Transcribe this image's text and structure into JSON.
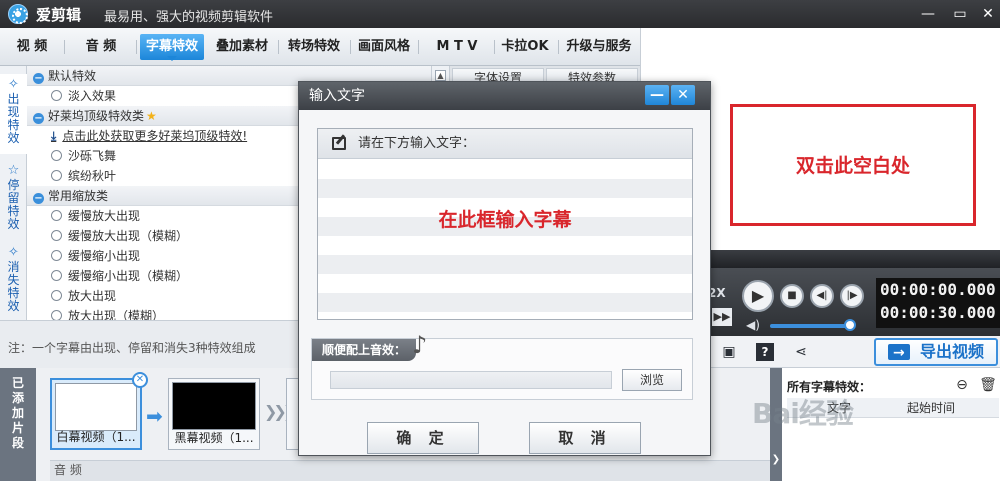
{
  "app": {
    "name": "爱剪辑",
    "slogan": "最易用、强大的视频剪辑软件"
  },
  "tabs": [
    {
      "label": "视 频"
    },
    {
      "label": "音 频"
    },
    {
      "label": "字幕特效",
      "active": true
    },
    {
      "label": "叠加素材"
    },
    {
      "label": "转场特效"
    },
    {
      "label": "画面风格"
    },
    {
      "label": "M T V"
    },
    {
      "label": "卡拉OK"
    },
    {
      "label": "升级与服务"
    }
  ],
  "categories": [
    {
      "label": "出现特效",
      "selected": true
    },
    {
      "label": "停留特效"
    },
    {
      "label": "消失特效"
    }
  ],
  "effects": {
    "group_default": "默认特效",
    "fade_in": "淡入效果",
    "group_hollywood": "好莱坞顶级特效类",
    "download_link": "点击此处获取更多好莱坞顶级特效!",
    "sand_fly": "沙砾飞舞",
    "autumn_leaves": "缤纷秋叶",
    "group_zoom": "常用缩放类",
    "slow_zoom_in": "缓慢放大出现",
    "slow_zoom_in_blur": "缓慢放大出现（模糊）",
    "slow_zoom_out": "缓慢缩小出现",
    "slow_zoom_out_blur": "缓慢缩小出现（模糊）",
    "zoom_in": "放大出现",
    "zoom_in_blur_partial": "放大出现（模糊）"
  },
  "side_tabs": {
    "font_settings": "字体设置",
    "effect_params": "特效参数"
  },
  "note": "注：一个字幕由出现、停留和消失3种特效组成",
  "timeline": {
    "added_label": "已添加片段",
    "clips": [
      {
        "caption": "白幕视频（1...",
        "color": "#ffffff"
      },
      {
        "caption": "黑幕视频（1...",
        "color": "#000000"
      }
    ],
    "audio_label": "音 频"
  },
  "preview": {
    "hint": "双击此空白处"
  },
  "player": {
    "speed": "2X",
    "time_current": "00:00:00.000",
    "time_total": "00:00:30.000",
    "volume": 0.9
  },
  "export_label": "导出视频",
  "subtitle_panel": {
    "title": "所有字幕特效：",
    "col_text": "文字",
    "col_time": "起始时间"
  },
  "dialog": {
    "title": "输入文字",
    "prompt": "请在下方输入文字：",
    "input_hint": "在此框输入字幕",
    "sound_label": "顺便配上音效：",
    "sound_value": "",
    "browse_label": "浏览",
    "ok_label": "确 定",
    "cancel_label": "取 消"
  },
  "watermark": "Bai经验"
}
